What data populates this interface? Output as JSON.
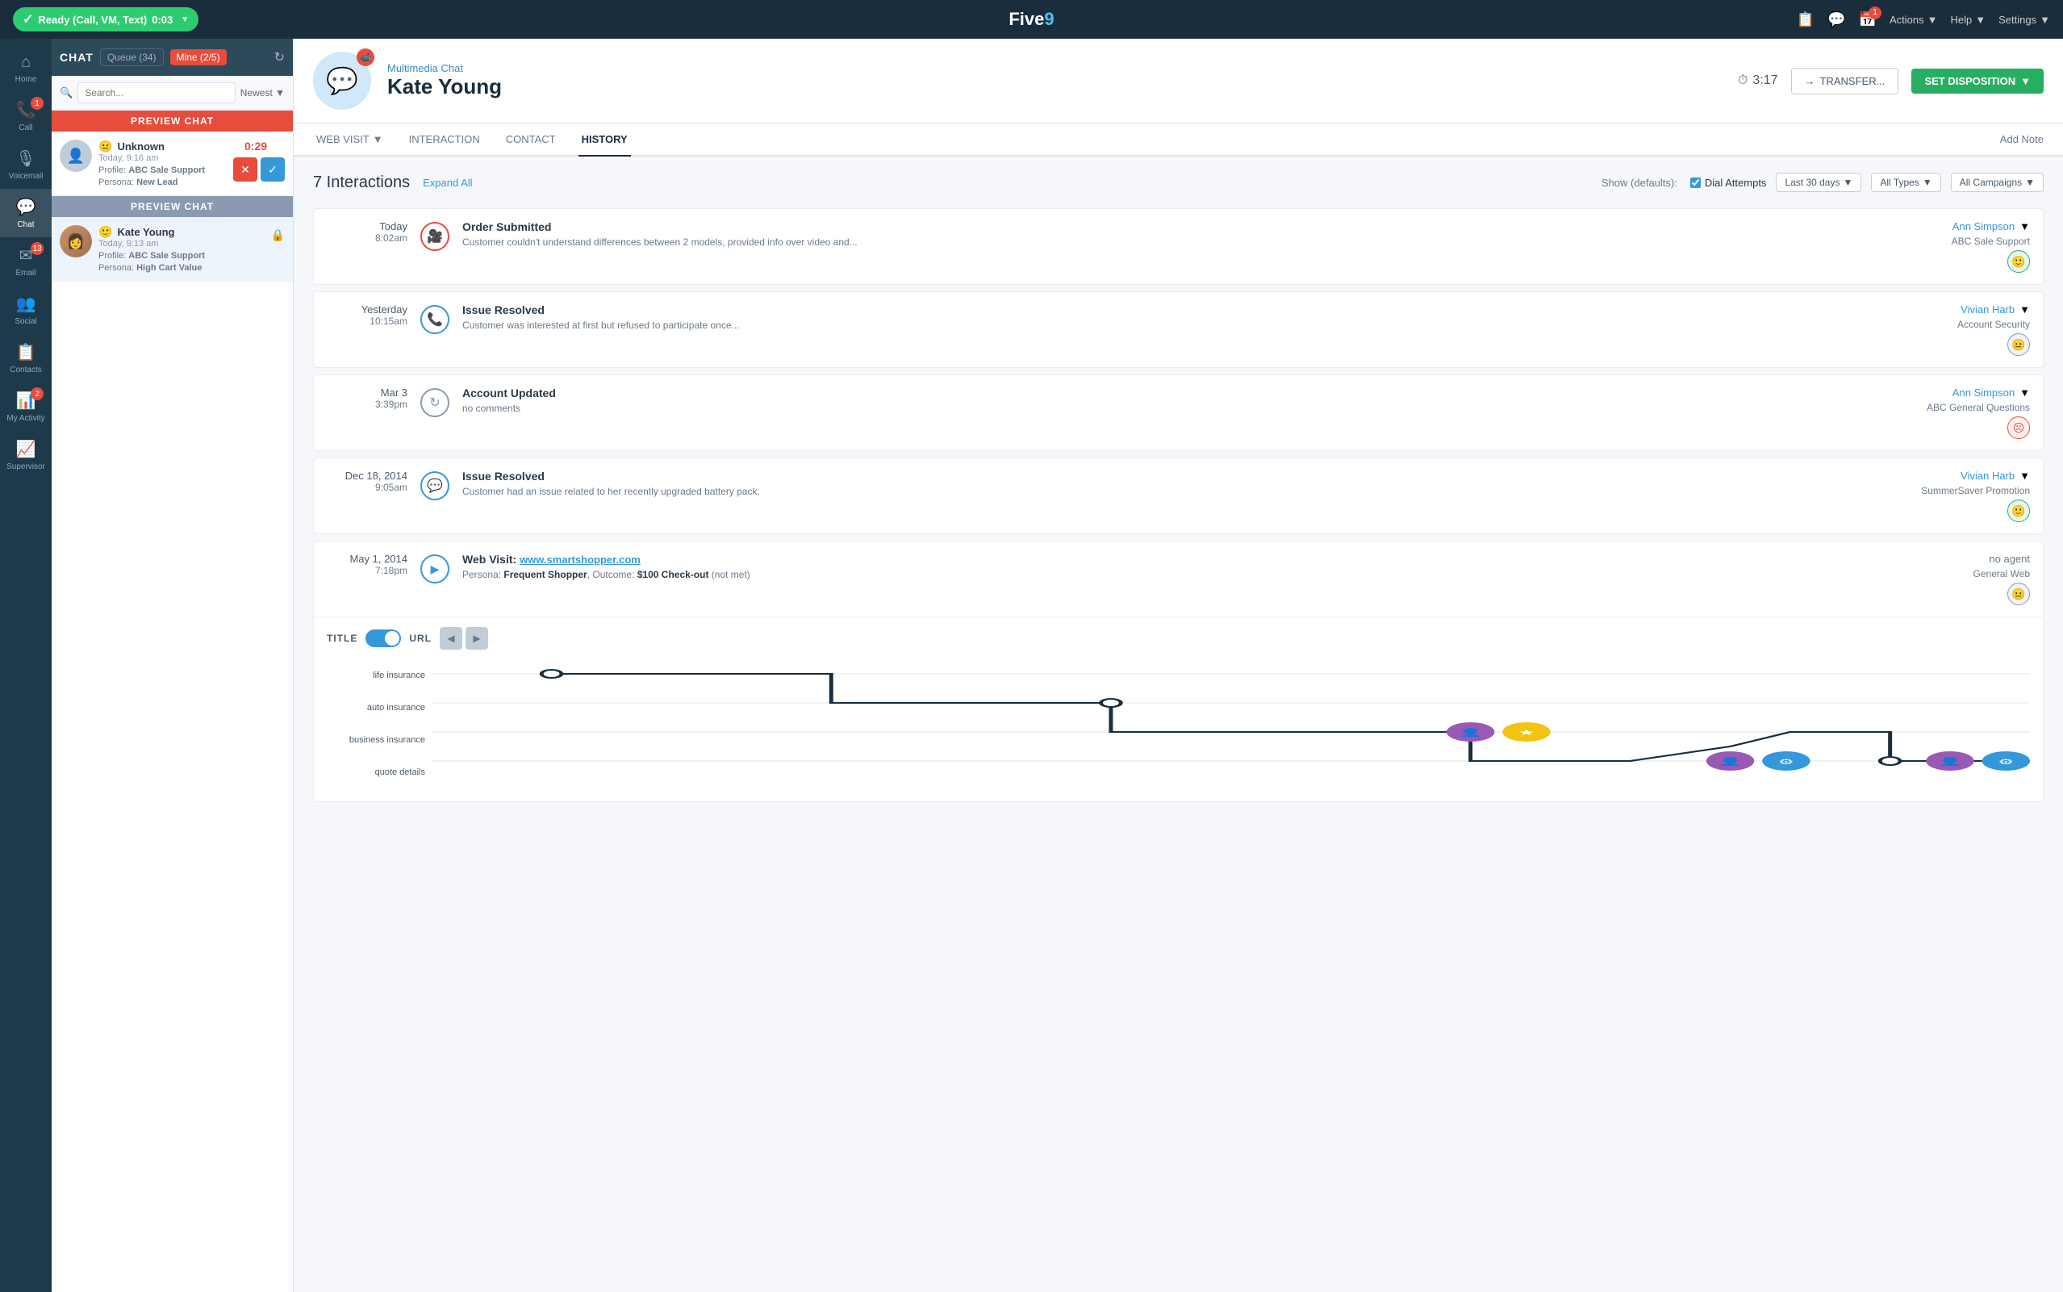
{
  "topbar": {
    "ready_label": "Ready (Call, VM, Text)",
    "timer": "0:03",
    "logo": "Five9",
    "actions_label": "Actions",
    "help_label": "Help",
    "settings_label": "Settings",
    "notification_count": "1"
  },
  "left_nav": {
    "items": [
      {
        "id": "home",
        "label": "Home",
        "icon": "⌂",
        "active": false,
        "badge": null
      },
      {
        "id": "call",
        "label": "Call",
        "icon": "📞",
        "active": false,
        "badge": "1"
      },
      {
        "id": "voicemail",
        "label": "Voicemail",
        "icon": "🎙",
        "active": false,
        "badge": null
      },
      {
        "id": "chat",
        "label": "Chat",
        "icon": "💬",
        "active": true,
        "badge": null
      },
      {
        "id": "email",
        "label": "Email",
        "icon": "✉",
        "active": false,
        "badge": "13"
      },
      {
        "id": "social",
        "label": "Social",
        "icon": "👥",
        "active": false,
        "badge": null
      },
      {
        "id": "contacts",
        "label": "Contacts",
        "icon": "📋",
        "active": false,
        "badge": null
      },
      {
        "id": "my_activity",
        "label": "My Activity",
        "icon": "📊",
        "active": false,
        "badge": "2"
      },
      {
        "id": "supervisor",
        "label": "Supervisor",
        "icon": "📈",
        "active": false,
        "badge": null
      }
    ]
  },
  "chat_panel": {
    "title": "CHAT",
    "queue_label": "Queue (34)",
    "mine_label": "Mine (2/5)",
    "search_placeholder": "Search...",
    "sort_label": "Newest",
    "preview_header_1": "PREVIEW CHAT",
    "preview_header_2": "PREVIEW CHAT",
    "chat_items": [
      {
        "id": "unknown",
        "name": "Unknown",
        "time": "Today, 9:16 am",
        "profile": "ABC Sale Support",
        "persona": "New Lead",
        "timer": "0:29",
        "emoji": "😐",
        "has_actions": true
      },
      {
        "id": "kate",
        "name": "Kate Young",
        "time": "Today, 9:13 am",
        "profile": "ABC Sale Support",
        "persona": "High Cart Value",
        "timer": null,
        "emoji": "🙂",
        "has_actions": false
      }
    ]
  },
  "content_header": {
    "subtitle": "Multimedia Chat",
    "name": "Kate Young",
    "timer": "3:17",
    "transfer_label": "TRANSFER...",
    "set_disposition_label": "SET DISPOSITION"
  },
  "tabs": {
    "items": [
      {
        "id": "web-visit",
        "label": "WEB VISIT",
        "has_dropdown": true,
        "active": false
      },
      {
        "id": "interaction",
        "label": "INTERACTION",
        "has_dropdown": false,
        "active": false
      },
      {
        "id": "contact",
        "label": "CONTACT",
        "has_dropdown": false,
        "active": false
      },
      {
        "id": "history",
        "label": "HISTORY",
        "has_dropdown": false,
        "active": true
      }
    ],
    "add_note_label": "Add Note"
  },
  "history": {
    "interactions_label": "7 Interactions",
    "expand_all_label": "Expand All",
    "show_label": "Show (defaults):",
    "dial_attempts_label": "Dial Attempts",
    "last_30_days_label": "Last 30 days",
    "all_types_label": "All Types",
    "all_campaigns_label": "All Campaigns",
    "interactions": [
      {
        "date_label": "Today",
        "time": "8:02am",
        "icon_type": "video",
        "title": "Order Submitted",
        "desc": "Customer couldn't understand differences between 2 models, provided info over video and...",
        "agent": "Ann Simpson",
        "campaign": "ABC Sale Support",
        "sentiment": "positive"
      },
      {
        "date_label": "Yesterday",
        "time": "10:15am",
        "icon_type": "phone",
        "title": "Issue Resolved",
        "desc": "Customer was interested at first but refused to participate once...",
        "agent": "Vivian Harb",
        "campaign": "Account Security",
        "sentiment": "neutral"
      },
      {
        "date_label": "Mar 3",
        "time": "3:39pm",
        "icon_type": "refresh",
        "title": "Account Updated",
        "desc": "no comments",
        "agent": "Ann Simpson",
        "campaign": "ABC General Questions",
        "sentiment": "negative"
      },
      {
        "date_label": "Dec 18, 2014",
        "time": "9:05am",
        "icon_type": "chat",
        "title": "Issue Resolved",
        "desc": "Customer had an issue related to her recently upgraded battery pack.",
        "agent": "Vivian Harb",
        "campaign": "SummerSaver Promotion",
        "sentiment": "positive"
      },
      {
        "date_label": "May 1, 2014",
        "time": "7:18pm",
        "icon_type": "web",
        "title": "Web Visit:",
        "url": "www.smartshopper.com",
        "persona_label": "Persona:",
        "persona": "Frequent Shopper",
        "outcome_label": "Outcome:",
        "outcome": "$100 Check-out",
        "outcome_note": "(not met)",
        "agent": "no agent",
        "campaign": "General Web",
        "sentiment": "neutral",
        "expanded": true
      }
    ],
    "web_visit_expanded": {
      "title_label": "TITLE",
      "url_label": "URL",
      "journey_rows": [
        {
          "label": "life insurance",
          "has_dot_start": true
        },
        {
          "label": "auto insurance",
          "has_dot_mid": true
        },
        {
          "label": "business insurance",
          "has_avatars": true
        },
        {
          "label": "quote details",
          "has_avatars": true
        }
      ]
    }
  }
}
